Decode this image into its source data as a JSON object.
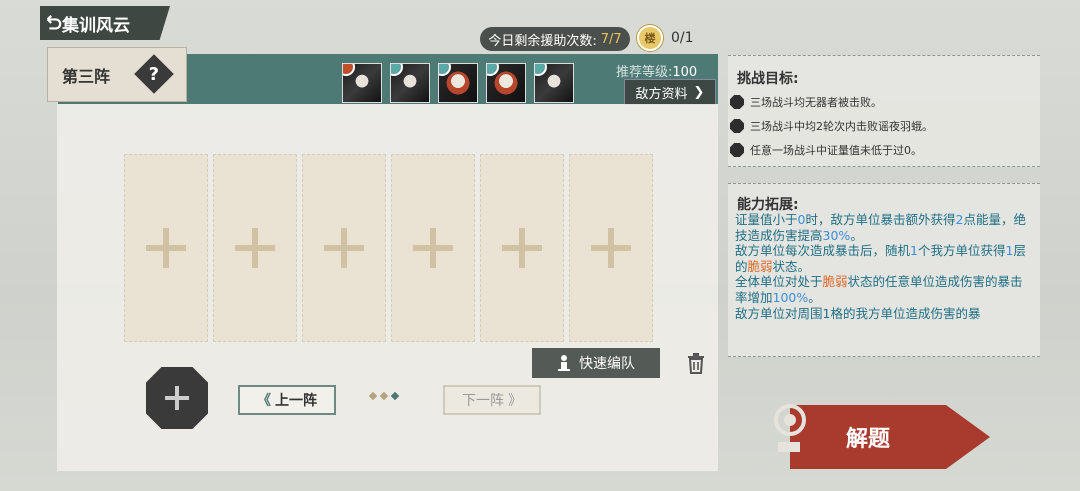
{
  "header": {
    "title": "集训风云",
    "formation": "第三阵",
    "help_symbol": "?"
  },
  "counters": {
    "assist_label": "今日剩余援助次数:",
    "assist_value": "7/7",
    "token_symbol": "楼",
    "token_value": "0/1"
  },
  "enemies": {
    "recommended_label": "推荐等级:",
    "recommended_value": "100",
    "info_button": "敌方资料",
    "info_arrow": "❯",
    "items": [
      {
        "name": "enemy-1"
      },
      {
        "name": "enemy-2"
      },
      {
        "name": "enemy-3"
      },
      {
        "name": "enemy-4"
      },
      {
        "name": "enemy-5"
      }
    ]
  },
  "formation_controls": {
    "quick_formation": "快速编队",
    "prev_label": "上一阵",
    "prev_arrows": "《",
    "next_label": "下一阵",
    "next_arrows": "》"
  },
  "goals": {
    "title": "挑战目标:",
    "items": [
      "三场战斗均无器者被击败。",
      "三场战斗中均2轮次内击败谣夜羽蛾。",
      "任意一场战斗中证量值未低于过0。"
    ]
  },
  "ability": {
    "title": "能力拓展:",
    "p1_a": "证量值小于",
    "p1_b": "0",
    "p1_c": "时，敌方单位暴击额外获得",
    "p1_d": "2",
    "p1_e": "点能量，绝技造成伤害提高",
    "p1_f": "30%",
    "p1_g": "。",
    "p2_a": "敌方单位每次造成暴击后，随机",
    "p2_b": "1",
    "p2_c": "个我方单位获得",
    "p2_d": "1",
    "p2_e": "层的",
    "p2_f": "脆弱",
    "p2_g": "状态。",
    "p3_a": "全体单位对处于",
    "p3_b": "脆弱",
    "p3_c": "状态的任意单位造成伤害的暴击率增加",
    "p3_d": "100%",
    "p3_e": "。",
    "p4": "敌方单位对周围1格的我方单位造成伤害的暴"
  },
  "solve_button": "解题"
}
